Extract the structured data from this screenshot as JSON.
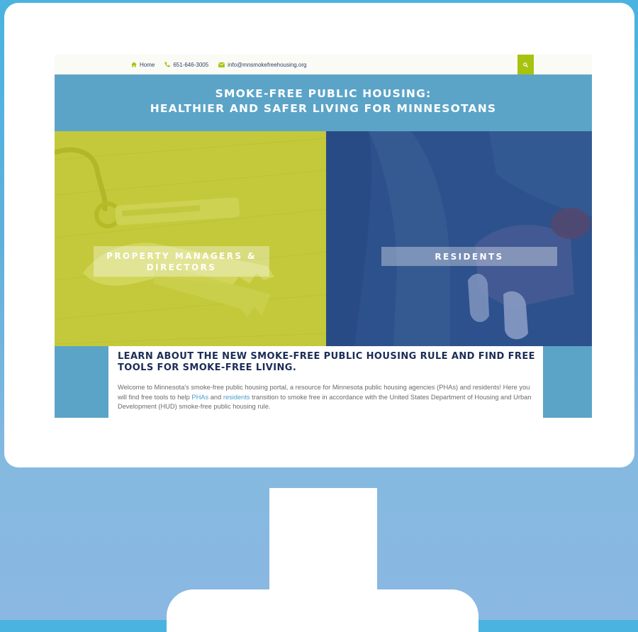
{
  "topbar": {
    "home_label": "Home",
    "phone": "651-646-3005",
    "email": "info@mnsmokefreehousing.org"
  },
  "banner": {
    "title_line1": "SMOKE-FREE PUBLIC HOUSING:",
    "title_line2": "HEALTHIER AND SAFER LIVING FOR MINNESOTANS"
  },
  "panels": {
    "property_managers": "PROPERTY MANAGERS & DIRECTORS",
    "residents": "RESIDENTS"
  },
  "content": {
    "heading": "LEARN ABOUT THE NEW SMOKE-FREE PUBLIC HOUSING RULE AND FIND FREE TOOLS FOR SMOKE-FREE LIVING.",
    "para_start": "Welcome to Minnesota's smoke-free public housing portal, a resource for Minnesota public housing agencies (PHAs) and residents! Here you will find free tools to help ",
    "link_phas": "PHAs",
    "para_and": " and ",
    "link_residents": "residents",
    "para_end": " transition to smoke free in accordance with the United States Department of Housing and Urban Development (HUD) smoke-free public housing rule."
  },
  "colors": {
    "accent_green": "#a8c210",
    "banner_blue": "#5ba4c8",
    "navy": "#1b2c57",
    "link_blue": "#4a9cc9"
  },
  "icons": [
    "home-icon",
    "phone-icon",
    "envelope-icon",
    "search-icon"
  ]
}
